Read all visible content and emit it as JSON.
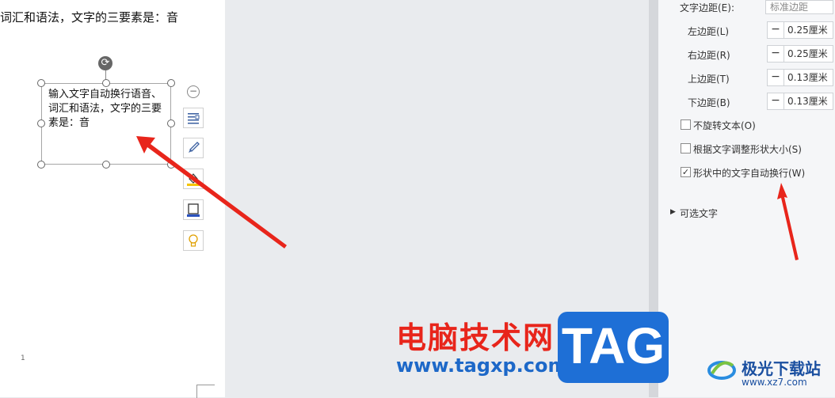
{
  "document": {
    "top_line": "词汇和语法，文字的三要素是：音",
    "page_number": "1",
    "shape_text": "输入文字自动换行语音、词汇和语法，文字的三要素是：音"
  },
  "toolbar": {
    "collapse_label": "−",
    "tools": [
      "layout-options-icon",
      "brush-icon",
      "fill-bucket-icon",
      "outline-icon",
      "lightbulb-icon"
    ]
  },
  "panel": {
    "text_margin_label": "文字边距(E):",
    "text_margin_value": "标准边距",
    "margins": [
      {
        "label": "左边距(L)",
        "value": "0.25厘米"
      },
      {
        "label": "右边距(R)",
        "value": "0.25厘米"
      },
      {
        "label": "上边距(T)",
        "value": "0.13厘米"
      },
      {
        "label": "下边距(B)",
        "value": "0.13厘米"
      }
    ],
    "minus": "−",
    "checkboxes": [
      {
        "label": "不旋转文本(O)",
        "checked": false,
        "mark": ""
      },
      {
        "label": "根据文字调整形状大小(S)",
        "checked": false,
        "mark": ""
      },
      {
        "label": "形状中的文字自动换行(W)",
        "checked": true,
        "mark": "✓"
      }
    ],
    "optional_text_label": "可选文字"
  },
  "watermark": {
    "cn_title": "电脑技术网",
    "url": "www.tagxp.com",
    "tag": "TAG",
    "site2_name": "极光下载站",
    "site2_url": "www.xz7.com"
  },
  "colors": {
    "arrow": "#e8251b",
    "accent_blue": "#1e6fd6"
  }
}
